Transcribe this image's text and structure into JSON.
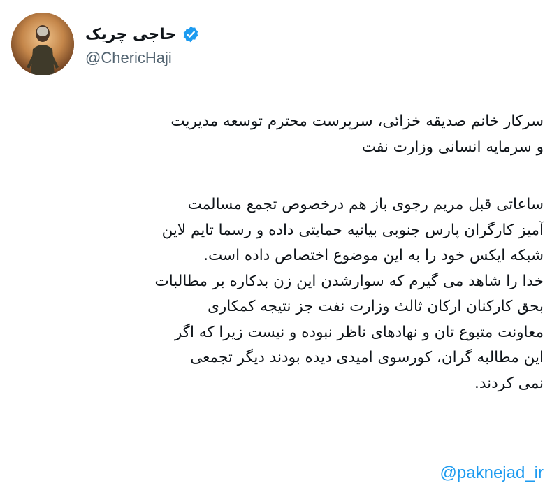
{
  "profile": {
    "display_name": "حاجی چریک",
    "handle": "@ChericHaji",
    "verified": true,
    "verified_color": "#1d9bf0"
  },
  "tweet": {
    "paragraph1": [
      "سرکار خانم صدیقه خزائی، سرپرست محترم توسعه مدیریت",
      "و سرمایه انسانی وزارت نفت"
    ],
    "paragraph2": [
      "ساعاتی قبل مریم رجوی باز هم درخصوص تجمع مسالمت",
      "آمیز کارگران پارس جنوبی بیانیه حمایتی داده و رسما تایم لاین",
      "شبکه ایکس خود را به این موضوع اختصاص داده  است.",
      "خدا را شاهد می گیرم که سوارشدن این زن بدکاره بر مطالبات",
      "بحق کارکنان ارکان ثالث وزارت نفت جز نتیجه کمکاری",
      "معاونت متبوع تان و نهادهای ناظر نبوده و نیست زیرا که اگر",
      "این مطالبه گران، کورسوی امیدی دیده بودند دیگر تجمعی",
      "نمی کردند."
    ],
    "mention": "@paknejad_ir",
    "link_color": "#1d9bf0"
  }
}
